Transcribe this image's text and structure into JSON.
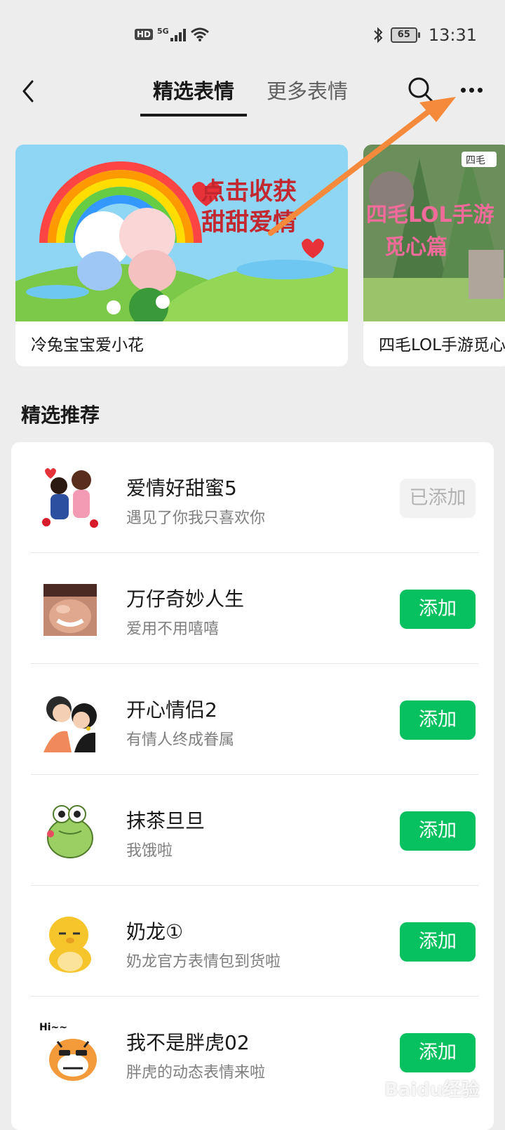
{
  "status_bar": {
    "hd": "HD",
    "network": "5G",
    "battery": "65",
    "time": "13:31"
  },
  "nav": {
    "tab_selected": "精选表情",
    "tab_more": "更多表情"
  },
  "banners": [
    {
      "caption": "冷兔宝宝爱小花",
      "art_text": "点击收获\n甜甜爱情"
    },
    {
      "caption": "四毛LOL手游觅心篇",
      "art_text": "四毛LOL手游\n觅心篇",
      "logo": "四毛"
    }
  ],
  "section": {
    "title": "精选推荐"
  },
  "list": [
    {
      "name": "爱情好甜蜜5",
      "desc": "遇见了你我只喜欢你",
      "button": "已添加",
      "added": true,
      "icon": "kissing-couple-icon"
    },
    {
      "name": "万仔奇妙人生",
      "desc": "爱用不用嘻嘻",
      "button": "添加",
      "added": false,
      "icon": "face-photo-icon"
    },
    {
      "name": "开心情侣2",
      "desc": "有情人终成眷属",
      "button": "添加",
      "added": false,
      "icon": "happy-couple-icon"
    },
    {
      "name": "抹茶旦旦",
      "desc": "我饿啦",
      "button": "添加",
      "added": false,
      "icon": "green-dino-icon"
    },
    {
      "name": "奶龙①",
      "desc": "奶龙官方表情包到货啦",
      "button": "添加",
      "added": false,
      "icon": "yellow-dragon-icon"
    },
    {
      "name": "我不是胖虎02",
      "desc": "胖虎的动态表情来啦",
      "button": "添加",
      "added": false,
      "icon": "tiger-icon",
      "thumb_text": "Hi~~"
    }
  ],
  "watermark": "Baidu经验",
  "colors": {
    "accent": "#07c160",
    "background": "#ededed",
    "arrow": "#f58a3c"
  }
}
